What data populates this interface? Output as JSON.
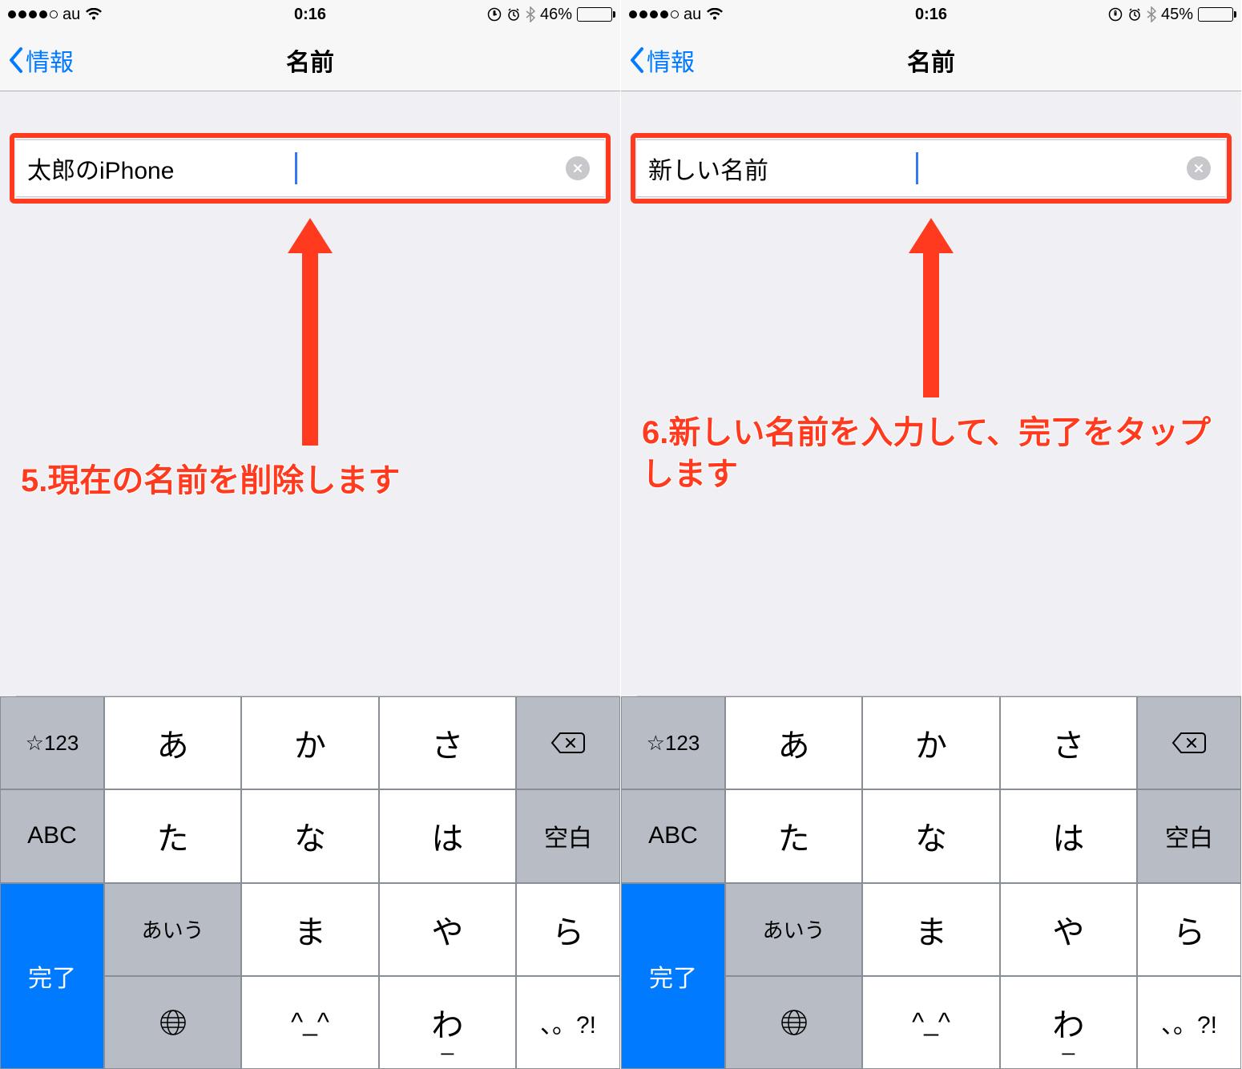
{
  "screens": [
    {
      "status": {
        "carrier": "au",
        "time": "0:16",
        "battery_pct": "46%",
        "battery_fill": 46
      },
      "nav": {
        "back_label": "情報",
        "title": "名前"
      },
      "input": {
        "value": "太郎のiPhone"
      },
      "arrow_shaft_height": 240,
      "annotation": "5.現在の名前を削除します",
      "annotation_class": "ann-left"
    },
    {
      "status": {
        "carrier": "au",
        "time": "0:16",
        "battery_pct": "45%",
        "battery_fill": 45
      },
      "nav": {
        "back_label": "情報",
        "title": "名前"
      },
      "input": {
        "value": "新しい名前"
      },
      "arrow_shaft_height": 180,
      "annotation": "6.新しい名前を入力して、完了をタップします",
      "annotation_class": "ann-right"
    }
  ],
  "keyboard": {
    "mode_num": "☆123",
    "mode_abc": "ABC",
    "mode_kana": "あいう",
    "space": "空白",
    "done": "完了",
    "rows": [
      [
        "あ",
        "か",
        "さ"
      ],
      [
        "た",
        "な",
        "は"
      ],
      [
        "ま",
        "や",
        "ら"
      ],
      [
        "^_^",
        "わ",
        "、。?!"
      ]
    ],
    "wa_underline": "ー"
  }
}
